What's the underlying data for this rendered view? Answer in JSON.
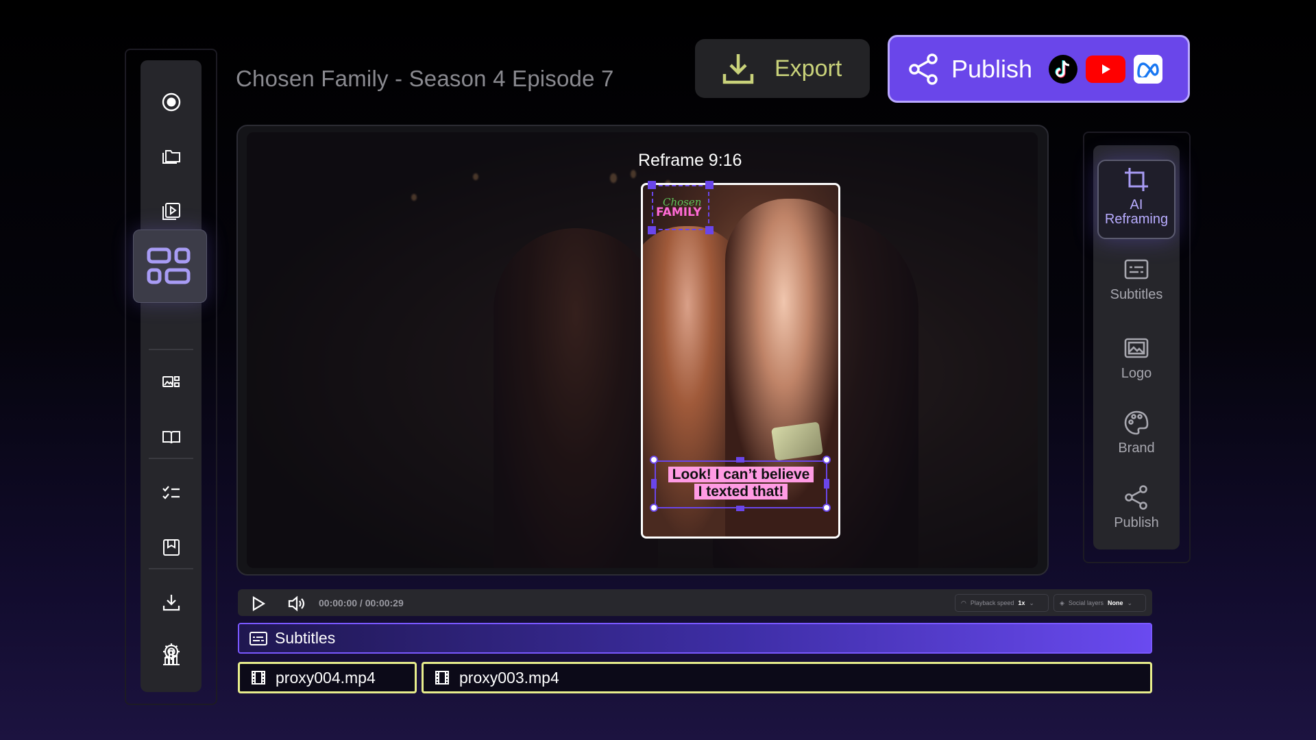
{
  "header": {
    "title": "Chosen Family - Season 4 Episode 7",
    "export_label": "Export",
    "publish_label": "Publish",
    "publish_targets": [
      "tiktok-icon",
      "youtube-icon",
      "meta-icon"
    ],
    "accent_color": "#6a46ea"
  },
  "sidebar": {
    "items": [
      {
        "name": "record-icon"
      },
      {
        "name": "folder-icon"
      },
      {
        "name": "media-library-icon"
      },
      {
        "name": "templates-icon",
        "active": true
      },
      {
        "name": "gallery-icon"
      },
      {
        "name": "book-icon"
      },
      {
        "name": "checklist-icon"
      },
      {
        "name": "bookmark-icon"
      },
      {
        "name": "download-icon"
      },
      {
        "name": "analytics-icon"
      },
      {
        "name": "settings-icon"
      }
    ]
  },
  "preview": {
    "reframe_label": "Reframe 9:16",
    "logo_line1": "Chosen",
    "logo_line2": "FAMILY",
    "subtitle_line1": "Look! I can’t believe",
    "subtitle_line2": "I texted that!"
  },
  "right_panel": {
    "items": [
      {
        "label": "AI\nReframing",
        "icon": "crop-icon",
        "active": true
      },
      {
        "label": "Subtitles",
        "icon": "subtitles-icon"
      },
      {
        "label": "Logo",
        "icon": "logo-image-icon"
      },
      {
        "label": "Brand",
        "icon": "palette-icon"
      },
      {
        "label": "Publish",
        "icon": "share-icon"
      }
    ]
  },
  "playback": {
    "time": "00:00:00 / 00:00:29",
    "speed_label": "Playback speed",
    "speed_value": "1x",
    "layers_label": "Social layers",
    "layers_value": "None"
  },
  "timeline": {
    "subtitles_track": "Subtitles",
    "clips": [
      "proxy004.mp4",
      "proxy003.mp4"
    ]
  }
}
